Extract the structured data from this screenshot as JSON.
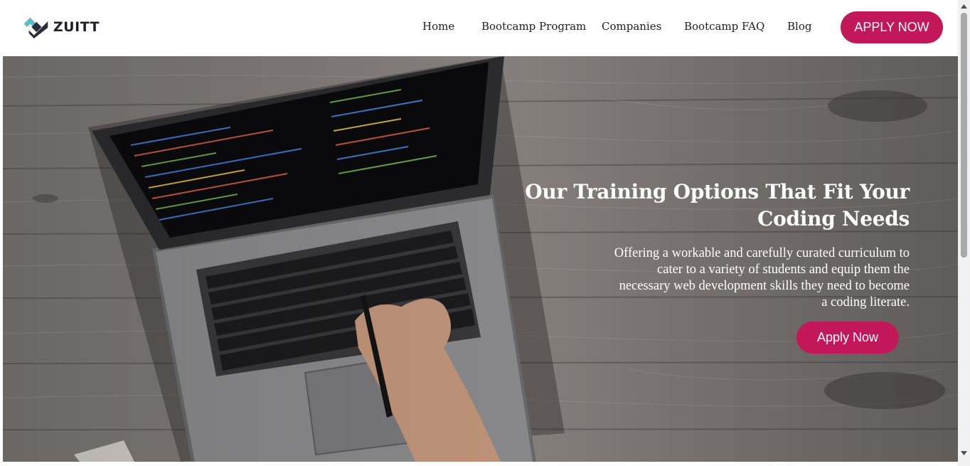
{
  "brand": {
    "name": "ZUITT"
  },
  "nav": {
    "items": [
      {
        "label": "Home"
      },
      {
        "label": "Bootcamp Program"
      },
      {
        "label": "Companies"
      },
      {
        "label": "Bootcamp FAQ"
      },
      {
        "label": "Blog"
      }
    ],
    "cta_label": "APPLY NOW"
  },
  "hero": {
    "title": "Our Training Options That Fit Your Coding Needs",
    "description": "Offering a workable and carefully curated curriculum to cater to a variety of students and equip them the necessary web development skills they need to become a coding literate.",
    "cta_label": "Apply Now"
  },
  "colors": {
    "accent": "#c21859",
    "logo_light": "#5bbcd0",
    "logo_dark": "#2b2d3c"
  },
  "icons": {
    "logo": "zuitt-logo-icon",
    "scroll_up": "chevron-up-icon",
    "scroll_down": "chevron-down-icon"
  }
}
